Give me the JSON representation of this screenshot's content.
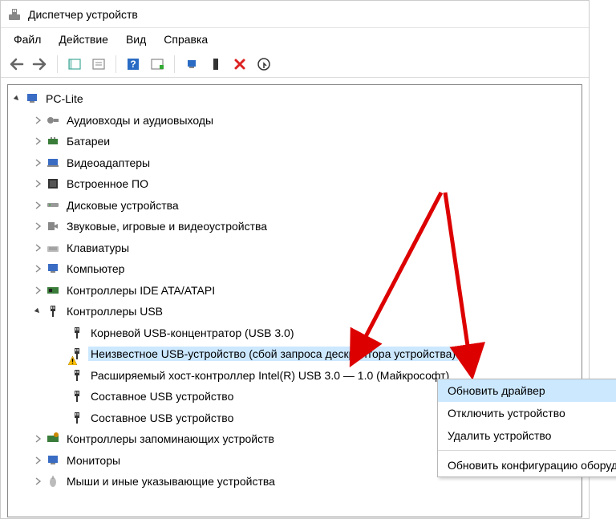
{
  "window": {
    "title": "Диспетчер устройств"
  },
  "menubar": {
    "items": [
      "Файл",
      "Действие",
      "Вид",
      "Справка"
    ]
  },
  "tree": {
    "root": "PC-Lite",
    "categories": [
      {
        "label": "Аудиовходы и аудиовыходы",
        "children": []
      },
      {
        "label": "Батареи",
        "children": []
      },
      {
        "label": "Видеоадаптеры",
        "children": []
      },
      {
        "label": "Встроенное ПО",
        "children": []
      },
      {
        "label": "Дисковые устройства",
        "children": []
      },
      {
        "label": "Звуковые, игровые и видеоустройства",
        "children": []
      },
      {
        "label": "Клавиатуры",
        "children": []
      },
      {
        "label": "Компьютер",
        "children": []
      },
      {
        "label": "Контроллеры IDE ATA/ATAPI",
        "children": []
      },
      {
        "label": "Контроллеры USB",
        "expanded": true,
        "children": [
          {
            "label": "Корневой USB-концентратор (USB 3.0)"
          },
          {
            "label": "Неизвестное USB-устройство (сбой запроса дескриптора устройства)",
            "warn": true,
            "selected": true
          },
          {
            "label": "Расширяемый хост-контроллер Intel(R) USB 3.0 — 1.0 (Майкрософт)"
          },
          {
            "label": "Составное USB устройство"
          },
          {
            "label": "Составное USB устройство"
          }
        ]
      },
      {
        "label": "Контроллеры запоминающих устройств",
        "children": []
      },
      {
        "label": "Мониторы",
        "children": []
      },
      {
        "label": "Мыши и иные указывающие устройства",
        "children": []
      }
    ]
  },
  "context_menu": {
    "items": [
      "Обновить драйвер",
      "Отключить устройство",
      "Удалить устройство"
    ],
    "sep_after": 2,
    "items2": [
      "Обновить конфигурацию оборудования"
    ]
  }
}
